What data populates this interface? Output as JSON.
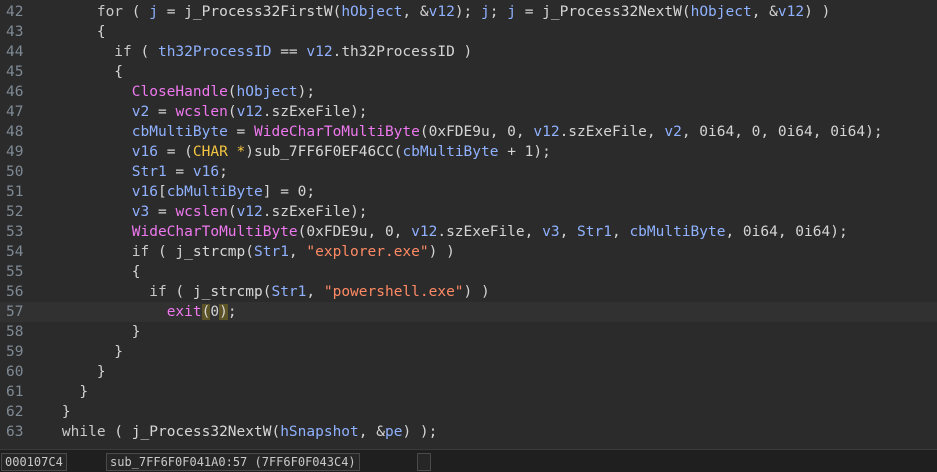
{
  "code_lines": [
    {
      "num": "42",
      "segs": [
        [
          "kw",
          "        for"
        ],
        [
          "pn",
          " ( "
        ],
        [
          "var",
          "j"
        ],
        [
          "pn",
          " = "
        ],
        [
          "fn",
          "j_Process32FirstW"
        ],
        [
          "pn",
          "("
        ],
        [
          "var",
          "hObject"
        ],
        [
          "pn",
          ", &"
        ],
        [
          "var",
          "v12"
        ],
        [
          "pn",
          "); "
        ],
        [
          "var",
          "j"
        ],
        [
          "pn",
          "; "
        ],
        [
          "var",
          "j"
        ],
        [
          "pn",
          " = "
        ],
        [
          "fn",
          "j_Process32NextW"
        ],
        [
          "pn",
          "("
        ],
        [
          "var",
          "hObject"
        ],
        [
          "pn",
          ", &"
        ],
        [
          "var",
          "v12"
        ],
        [
          "pn",
          ") )"
        ]
      ]
    },
    {
      "num": "43",
      "segs": [
        [
          "pn",
          "        {"
        ]
      ]
    },
    {
      "num": "44",
      "segs": [
        [
          "kw",
          "          if"
        ],
        [
          "pn",
          " ( "
        ],
        [
          "var",
          "th32ProcessID"
        ],
        [
          "pn",
          " == "
        ],
        [
          "var",
          "v12"
        ],
        [
          "pn",
          ".th32ProcessID )"
        ]
      ]
    },
    {
      "num": "45",
      "segs": [
        [
          "pn",
          "          {"
        ]
      ]
    },
    {
      "num": "46",
      "segs": [
        [
          "pn",
          "            "
        ],
        [
          "api",
          "CloseHandle"
        ],
        [
          "pn",
          "("
        ],
        [
          "var",
          "hObject"
        ],
        [
          "pn",
          ");"
        ]
      ]
    },
    {
      "num": "47",
      "segs": [
        [
          "pn",
          "            "
        ],
        [
          "var",
          "v2"
        ],
        [
          "pn",
          " = "
        ],
        [
          "api",
          "wcslen"
        ],
        [
          "pn",
          "("
        ],
        [
          "var",
          "v12"
        ],
        [
          "pn",
          ".szExeFile);"
        ]
      ]
    },
    {
      "num": "48",
      "segs": [
        [
          "pn",
          "            "
        ],
        [
          "var",
          "cbMultiByte"
        ],
        [
          "pn",
          " = "
        ],
        [
          "api",
          "WideCharToMultiByte"
        ],
        [
          "pn",
          "(0xFDE9u, 0, "
        ],
        [
          "var",
          "v12"
        ],
        [
          "pn",
          ".szExeFile, "
        ],
        [
          "var",
          "v2"
        ],
        [
          "pn",
          ", 0i64, 0, 0i64, 0i64);"
        ]
      ]
    },
    {
      "num": "49",
      "segs": [
        [
          "pn",
          "            "
        ],
        [
          "var",
          "v16"
        ],
        [
          "pn",
          " = ("
        ],
        [
          "typ",
          "CHAR *"
        ],
        [
          "pn",
          ")"
        ],
        [
          "fn",
          "sub_7FF6F0EF46CC"
        ],
        [
          "pn",
          "("
        ],
        [
          "var",
          "cbMultiByte"
        ],
        [
          "pn",
          " + 1);"
        ]
      ]
    },
    {
      "num": "50",
      "segs": [
        [
          "pn",
          "            "
        ],
        [
          "var",
          "Str1"
        ],
        [
          "pn",
          " = "
        ],
        [
          "var",
          "v16"
        ],
        [
          "pn",
          ";"
        ]
      ]
    },
    {
      "num": "51",
      "segs": [
        [
          "pn",
          "            "
        ],
        [
          "var",
          "v16"
        ],
        [
          "pn",
          "["
        ],
        [
          "var",
          "cbMultiByte"
        ],
        [
          "pn",
          "] = 0;"
        ]
      ]
    },
    {
      "num": "52",
      "segs": [
        [
          "pn",
          "            "
        ],
        [
          "var",
          "v3"
        ],
        [
          "pn",
          " = "
        ],
        [
          "api",
          "wcslen"
        ],
        [
          "pn",
          "("
        ],
        [
          "var",
          "v12"
        ],
        [
          "pn",
          ".szExeFile);"
        ]
      ]
    },
    {
      "num": "53",
      "segs": [
        [
          "pn",
          "            "
        ],
        [
          "api",
          "WideCharToMultiByte"
        ],
        [
          "pn",
          "(0xFDE9u, 0, "
        ],
        [
          "var",
          "v12"
        ],
        [
          "pn",
          ".szExeFile, "
        ],
        [
          "var",
          "v3"
        ],
        [
          "pn",
          ", "
        ],
        [
          "var",
          "Str1"
        ],
        [
          "pn",
          ", "
        ],
        [
          "var",
          "cbMultiByte"
        ],
        [
          "pn",
          ", 0i64, 0i64);"
        ]
      ]
    },
    {
      "num": "54",
      "segs": [
        [
          "kw",
          "            if"
        ],
        [
          "pn",
          " ( "
        ],
        [
          "fn",
          "j_strcmp"
        ],
        [
          "pn",
          "("
        ],
        [
          "var",
          "Str1"
        ],
        [
          "pn",
          ", "
        ],
        [
          "str",
          "\"explorer.exe\""
        ],
        [
          "pn",
          ") )"
        ]
      ]
    },
    {
      "num": "55",
      "segs": [
        [
          "pn",
          "            {"
        ]
      ]
    },
    {
      "num": "56",
      "segs": [
        [
          "kw",
          "              if"
        ],
        [
          "pn",
          " ( "
        ],
        [
          "fn",
          "j_strcmp"
        ],
        [
          "pn",
          "("
        ],
        [
          "var",
          "Str1"
        ],
        [
          "pn",
          ", "
        ],
        [
          "str",
          "\"powershell.exe\""
        ],
        [
          "pn",
          ") )"
        ]
      ]
    },
    {
      "num": "57",
      "segs": [
        [
          "pn",
          "                "
        ],
        [
          "api",
          "exit"
        ],
        [
          "hl",
          "("
        ],
        [
          "pn",
          "0"
        ],
        [
          "hl",
          ")"
        ],
        [
          "pn",
          ";"
        ]
      ]
    },
    {
      "num": "58",
      "segs": [
        [
          "pn",
          "            }"
        ]
      ]
    },
    {
      "num": "59",
      "segs": [
        [
          "pn",
          "          }"
        ]
      ]
    },
    {
      "num": "60",
      "segs": [
        [
          "pn",
          "        }"
        ]
      ]
    },
    {
      "num": "61",
      "segs": [
        [
          "pn",
          "      }"
        ]
      ]
    },
    {
      "num": "62",
      "segs": [
        [
          "pn",
          "    }"
        ]
      ]
    },
    {
      "num": "63",
      "segs": [
        [
          "kw",
          "    while"
        ],
        [
          "pn",
          " ( "
        ],
        [
          "fn",
          "j_Process32NextW"
        ],
        [
          "pn",
          "("
        ],
        [
          "var",
          "hSnapshot"
        ],
        [
          "pn",
          ", &"
        ],
        [
          "var",
          "pe"
        ],
        [
          "pn",
          ") );"
        ]
      ]
    }
  ],
  "current_line": "57",
  "status": {
    "offset": "000107C4",
    "location": "sub_7FF6F0F041A0:57 (7FF6F0F043C4)"
  }
}
